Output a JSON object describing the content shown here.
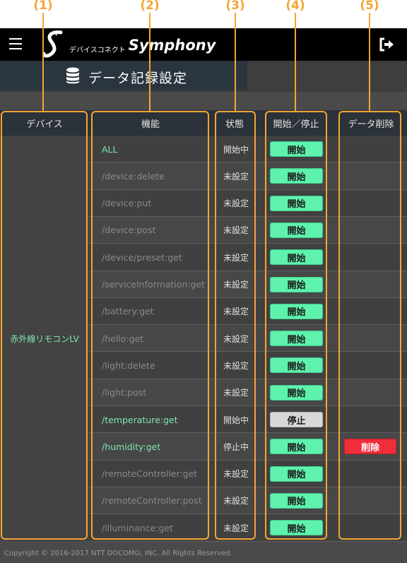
{
  "callouts": [
    "(1)",
    "(2)",
    "(3)",
    "(4)",
    "(5)"
  ],
  "header": {
    "logo_small": "デバイスコネクト",
    "logo_main": "Symphony",
    "menu_icon": "hamburger-icon",
    "logout_icon": "logout-icon"
  },
  "page_title": "データ記録設定",
  "page_title_icon": "database-icon",
  "table": {
    "headers": [
      "デバイス",
      "機能",
      "状態",
      "開始／停止",
      "データ削除"
    ],
    "device": "赤外線リモコンLV",
    "rows": [
      {
        "func": "ALL",
        "state": "開始中",
        "button": "開始",
        "button_type": "start",
        "active": true,
        "delete": ""
      },
      {
        "func": "/device:delete",
        "state": "未設定",
        "button": "開始",
        "button_type": "start",
        "active": false,
        "delete": ""
      },
      {
        "func": "/device:put",
        "state": "未設定",
        "button": "開始",
        "button_type": "start",
        "active": false,
        "delete": ""
      },
      {
        "func": "/device:post",
        "state": "未設定",
        "button": "開始",
        "button_type": "start",
        "active": false,
        "delete": ""
      },
      {
        "func": "/device/preset:get",
        "state": "未設定",
        "button": "開始",
        "button_type": "start",
        "active": false,
        "delete": ""
      },
      {
        "func": "/serviceInformation:get",
        "state": "未設定",
        "button": "開始",
        "button_type": "start",
        "active": false,
        "delete": ""
      },
      {
        "func": "/battery:get",
        "state": "未設定",
        "button": "開始",
        "button_type": "start",
        "active": false,
        "delete": ""
      },
      {
        "func": "/hello:get",
        "state": "未設定",
        "button": "開始",
        "button_type": "start",
        "active": false,
        "delete": ""
      },
      {
        "func": "/light:delete",
        "state": "未設定",
        "button": "開始",
        "button_type": "start",
        "active": false,
        "delete": ""
      },
      {
        "func": "/light:post",
        "state": "未設定",
        "button": "開始",
        "button_type": "start",
        "active": false,
        "delete": ""
      },
      {
        "func": "/temperature:get",
        "state": "開始中",
        "button": "停止",
        "button_type": "stop",
        "active": true,
        "delete": ""
      },
      {
        "func": "/humidity:get",
        "state": "停止中",
        "button": "開始",
        "button_type": "start",
        "active": true,
        "delete": "削除"
      },
      {
        "func": "/remoteController:get",
        "state": "未設定",
        "button": "開始",
        "button_type": "start",
        "active": false,
        "delete": ""
      },
      {
        "func": "/remoteController:post",
        "state": "未設定",
        "button": "開始",
        "button_type": "start",
        "active": false,
        "delete": ""
      },
      {
        "func": "/illuminance:get",
        "state": "未設定",
        "button": "開始",
        "button_type": "start",
        "active": false,
        "delete": ""
      }
    ]
  },
  "footer": "Copyright © 2016-2017 NTT DOCOMO, INC. All Rights Reserved.",
  "colors": {
    "accent_orange": "#f4a533",
    "start_green": "#5ff2ad",
    "delete_red": "#f02d3a",
    "active_text": "#7fe6b0"
  }
}
